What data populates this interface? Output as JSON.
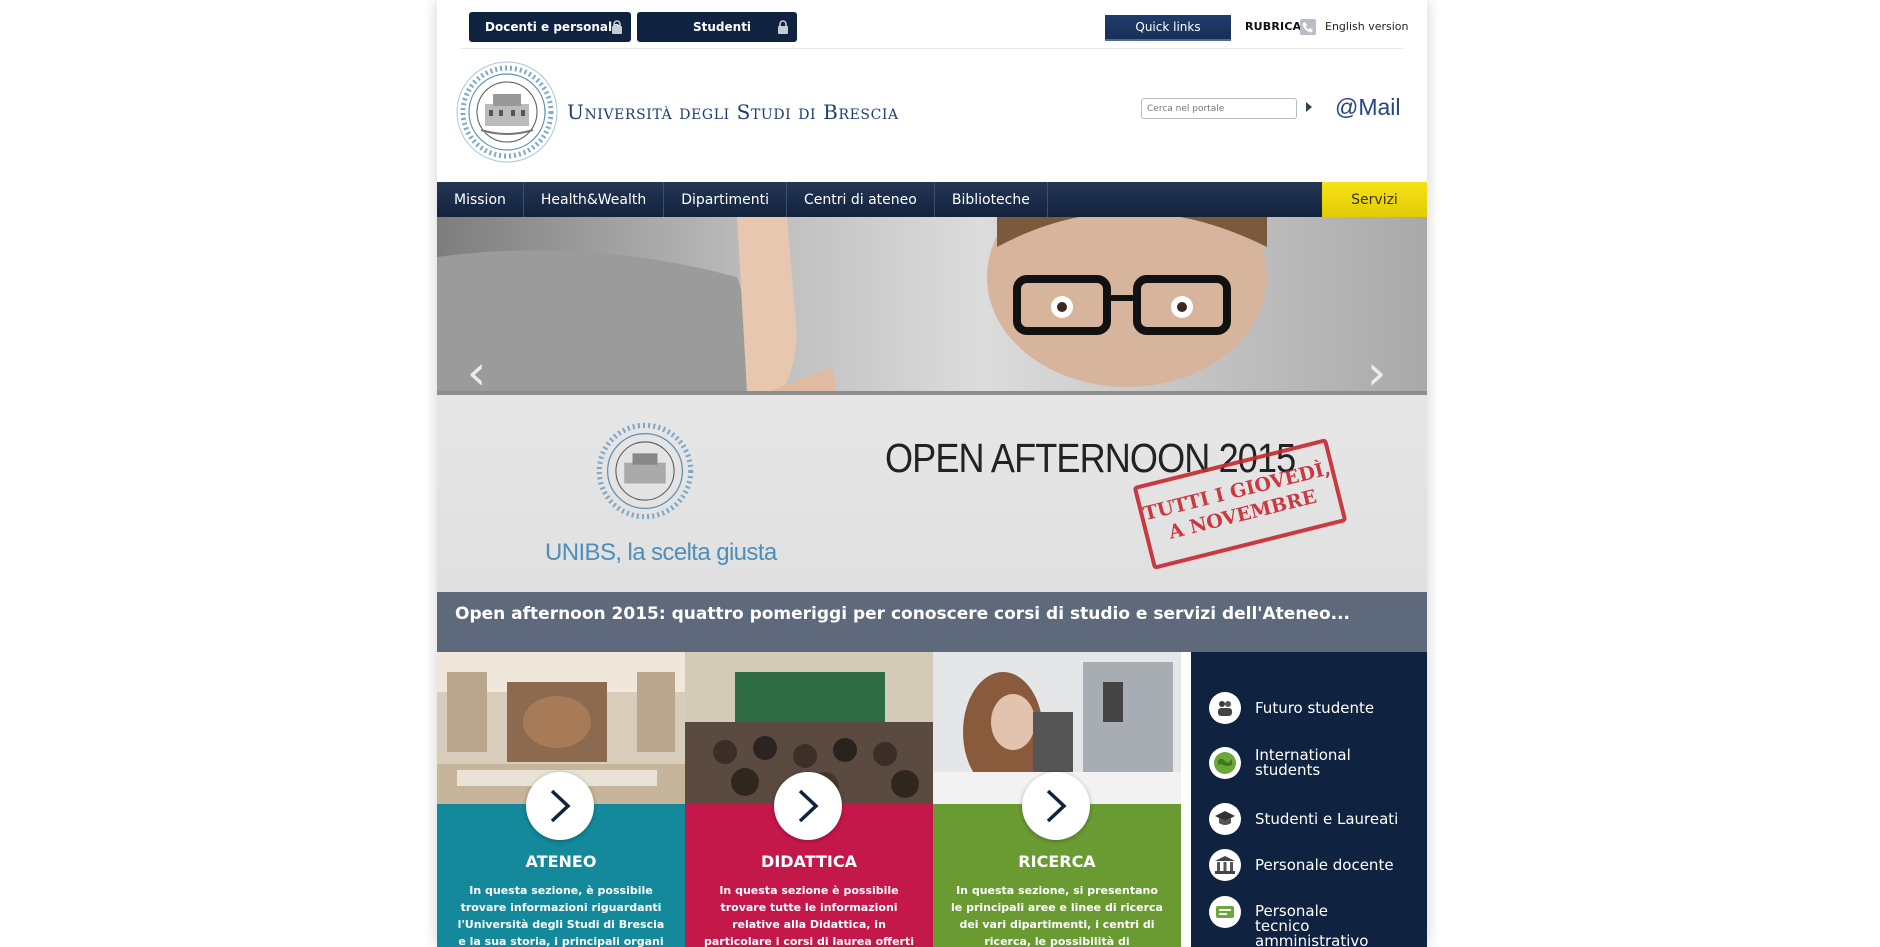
{
  "topbar": {
    "docenti_label": "Docenti e personale",
    "studenti_label": "Studenti",
    "quick_links": "Quick links",
    "rubrica": "RUBRICA",
    "english": "English version"
  },
  "header": {
    "title": "Università degli Studi di Brescia",
    "search_placeholder": "Cerca nel portale",
    "mail": "@Mail"
  },
  "nav": {
    "items": [
      "Mission",
      "Health&Wealth",
      "Dipartimenti",
      "Centri di ateneo",
      "Biblioteche"
    ],
    "servizi": "Servizi"
  },
  "banner": {
    "headline": "OPEN AFTERNOON 2015",
    "stamp_line1": "TUTTI I GIOVEDÌ,",
    "stamp_line2": "A NOVEMBRE",
    "tagline": "UNIBS, la scelta giusta",
    "caption": "Open afternoon 2015: quattro pomeriggi per conoscere corsi di studio e servizi dell'Ateneo..."
  },
  "tiles": [
    {
      "title": "ATENEO",
      "desc": "In questa sezione, è possibile trovare informazioni riguardanti l'Università degli Studi di Brescia e la sua storia, i principali organi di",
      "color": "#13899b"
    },
    {
      "title": "DIDATTICA",
      "desc": "In questa sezione è possibile trovare tutte le informazioni relative alla Didattica, in particolare i corsi di laurea offerti dall'Ateneo, i percorsi",
      "color": "#c4174a"
    },
    {
      "title": "RICERCA",
      "desc": "In questa sezione, si presentano le principali aree e linee di ricerca dei vari dipartimenti, i centri di ricerca, le possibilità di finanziamento delle",
      "color": "#6a9a32"
    }
  ],
  "panel": {
    "items": [
      "Futuro studente",
      "International students",
      "Studenti e Laureati",
      "Personale docente",
      "Personale tecnico amministrativo"
    ]
  },
  "colors": {
    "navy": "#0f2240",
    "servizi": "#f0d800",
    "caption_bg": "#5e6a7c"
  },
  "icons": [
    "lock-icon",
    "phone-icon",
    "seal-logo",
    "search-arrow-icon",
    "chevron-right-icon",
    "people-icon",
    "globe-icon",
    "graduation-cap-icon",
    "building-icon",
    "admin-icon"
  ]
}
